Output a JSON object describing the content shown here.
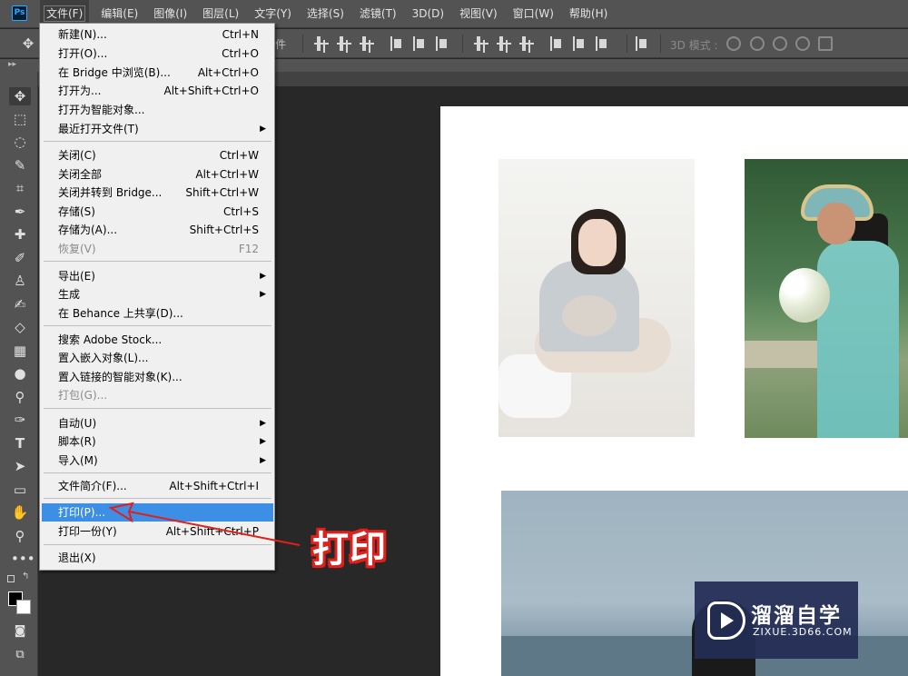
{
  "app": {
    "logo": "Ps"
  },
  "menubar": {
    "items": [
      "文件(F)",
      "编辑(E)",
      "图像(I)",
      "图层(L)",
      "文字(Y)",
      "选择(S)",
      "滤镜(T)",
      "3D(D)",
      "视图(V)",
      "窗口(W)",
      "帮助(H)"
    ],
    "active_index": 0
  },
  "optionsbar": {
    "fragment": "件",
    "mode_3d": "3D 模式 :"
  },
  "file_menu": {
    "items": [
      {
        "label": "新建(N)...",
        "shortcut": "Ctrl+N"
      },
      {
        "label": "打开(O)...",
        "shortcut": "Ctrl+O"
      },
      {
        "label": "在 Bridge 中浏览(B)...",
        "shortcut": "Alt+Ctrl+O"
      },
      {
        "label": "打开为...",
        "shortcut": "Alt+Shift+Ctrl+O"
      },
      {
        "label": "打开为智能对象...",
        "shortcut": ""
      },
      {
        "label": "最近打开文件(T)",
        "shortcut": "",
        "submenu": true
      },
      {
        "label": "关闭(C)",
        "shortcut": "Ctrl+W"
      },
      {
        "label": "关闭全部",
        "shortcut": "Alt+Ctrl+W"
      },
      {
        "label": "关闭并转到 Bridge...",
        "shortcut": "Shift+Ctrl+W"
      },
      {
        "label": "存储(S)",
        "shortcut": "Ctrl+S"
      },
      {
        "label": "存储为(A)...",
        "shortcut": "Shift+Ctrl+S"
      },
      {
        "label": "恢复(V)",
        "shortcut": "F12",
        "disabled": true
      },
      {
        "label": "导出(E)",
        "shortcut": "",
        "submenu": true
      },
      {
        "label": "生成",
        "shortcut": "",
        "submenu": true
      },
      {
        "label": "在 Behance 上共享(D)...",
        "shortcut": ""
      },
      {
        "label": "搜索 Adobe Stock...",
        "shortcut": ""
      },
      {
        "label": "置入嵌入对象(L)...",
        "shortcut": ""
      },
      {
        "label": "置入链接的智能对象(K)...",
        "shortcut": ""
      },
      {
        "label": "打包(G)...",
        "shortcut": "",
        "disabled": true
      },
      {
        "label": "自动(U)",
        "shortcut": "",
        "submenu": true
      },
      {
        "label": "脚本(R)",
        "shortcut": "",
        "submenu": true
      },
      {
        "label": "导入(M)",
        "shortcut": "",
        "submenu": true
      },
      {
        "label": "文件简介(F)...",
        "shortcut": "Alt+Shift+Ctrl+I"
      },
      {
        "label": "打印(P)...",
        "shortcut": "",
        "highlighted": true
      },
      {
        "label": "打印一份(Y)",
        "shortcut": "Alt+Shift+Ctrl+P"
      },
      {
        "label": "退出(X)",
        "shortcut": ""
      }
    ]
  },
  "annotation": {
    "label": "打印",
    "color": "#e0201a"
  },
  "watermark": {
    "cn": "溜溜自学",
    "en": "ZIXUE.3D66.COM"
  },
  "colors": {
    "highlight": "#3c8fe5",
    "ui_bg": "#535353",
    "canvas_bg": "#282828"
  }
}
